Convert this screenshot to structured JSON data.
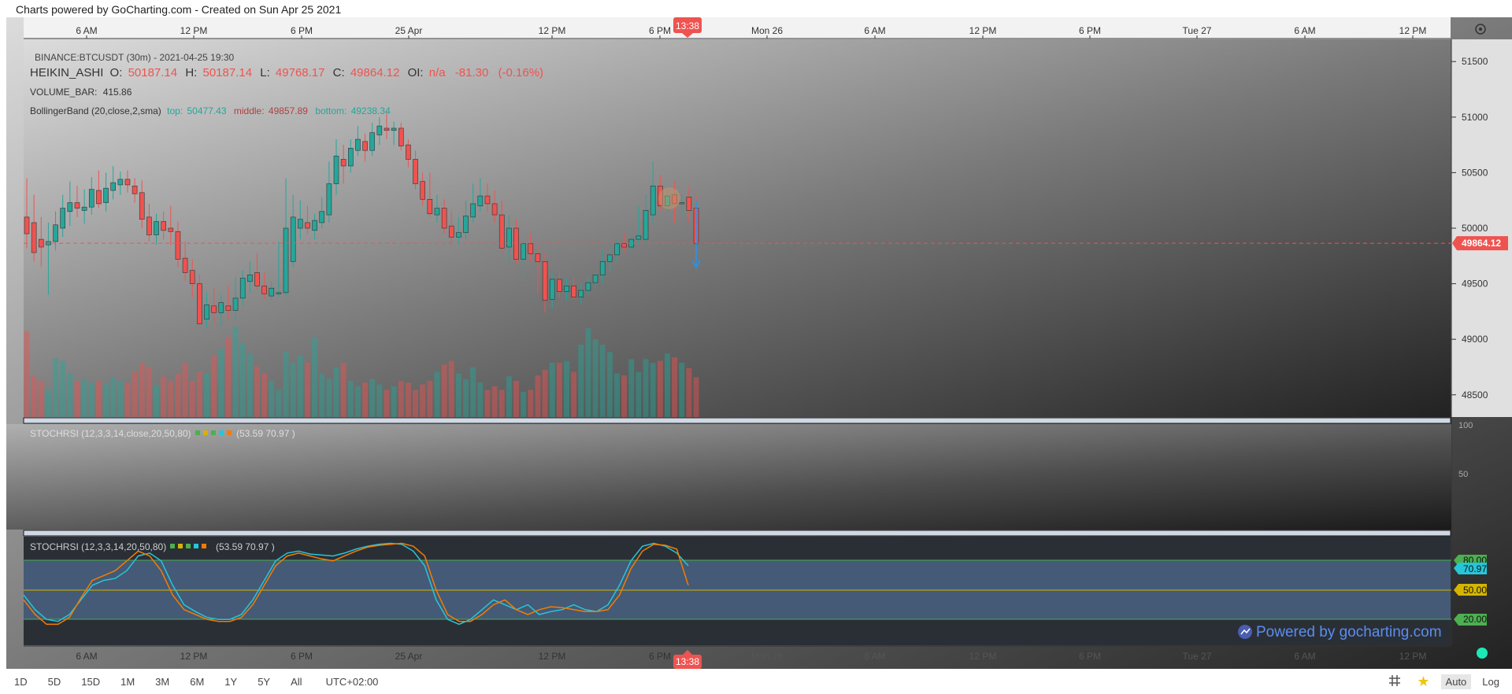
{
  "header": {
    "credit": "Charts powered by GoCharting.com - Created on Sun Apr 25 2021"
  },
  "timeaxis": {
    "ticks": [
      "6 AM",
      "12 PM",
      "6 PM",
      "25 Apr",
      "12 PM",
      "6 PM",
      "Mon 26",
      "6 AM",
      "12 PM",
      "6 PM",
      "Tue 27",
      "6 AM",
      "12 PM"
    ],
    "crosshair_time": "13:38"
  },
  "legend": {
    "symbol": "BINANCE:BTCUSDT (30m) - 2021-04-25 19:30",
    "ha_label": "HEIKIN_ASHI",
    "o_label": "O:",
    "o_value": "50187.14",
    "h_label": "H:",
    "h_value": "50187.14",
    "l_label": "L:",
    "l_value": "49768.17",
    "c_label": "C:",
    "c_value": "49864.12",
    "oi_label": "OI:",
    "oi_value": "n/a",
    "change": "-81.30",
    "change_pct": "(-0.16%)",
    "volume_label": "VOLUME_BAR:",
    "volume_value": "415.86",
    "bb_label": "BollingerBand (20,close,2,sma)",
    "bb_top_label": "top:",
    "bb_top": "50477.43",
    "bb_mid_label": "middle:",
    "bb_mid": "49857.89",
    "bb_bot_label": "bottom:",
    "bb_bot": "49238.34",
    "stoch1_label": "STOCHRSI (12,3,3,14,close,20,50,80)",
    "stoch1_values": "(53.59 70.97 )",
    "stoch2_label": "STOCHRSI (12,3,3,14,20,50,80)",
    "stoch2_values": "(53.59 70.97 )"
  },
  "price_axis": {
    "ticks": [
      "51500",
      "51000",
      "50500",
      "50000",
      "49500",
      "49000",
      "48500"
    ],
    "current": "49864.12",
    "current_color": "#ef5350"
  },
  "pane2_axis": [
    "100",
    "50"
  ],
  "stoch_levels": [
    "80.00",
    "50.00",
    "20.00"
  ],
  "stoch_badge": "70.97",
  "watermark": "Powered by gocharting.com",
  "colors": {
    "up": "#26a69a",
    "down": "#ef5350",
    "k_line": "#26c6da",
    "d_line": "#f57c00",
    "level_green": "#4caf50",
    "level_yellow": "#d4b400"
  },
  "bottom_bar": {
    "timeframes": [
      "1D",
      "5D",
      "15D",
      "1M",
      "3M",
      "6M",
      "1Y",
      "5Y",
      "All"
    ],
    "timezone": "UTC+02:00",
    "auto": "Auto",
    "log": "Log"
  },
  "chart_data": {
    "type": "candlestick",
    "title": "BINANCE:BTCUSDT (30m)",
    "ylim": [
      48300,
      51700
    ],
    "candles": [
      {
        "o": 50100,
        "h": 50450,
        "l": 49820,
        "c": 49950
      },
      {
        "o": 50050,
        "h": 50300,
        "l": 49700,
        "c": 49780
      },
      {
        "o": 49900,
        "h": 50100,
        "l": 49650,
        "c": 49830
      },
      {
        "o": 49850,
        "h": 50050,
        "l": 49400,
        "c": 49880
      },
      {
        "o": 49880,
        "h": 50150,
        "l": 49800,
        "c": 50030
      },
      {
        "o": 50000,
        "h": 50300,
        "l": 49920,
        "c": 50180
      },
      {
        "o": 50150,
        "h": 50420,
        "l": 50020,
        "c": 50230
      },
      {
        "o": 50230,
        "h": 50380,
        "l": 50100,
        "c": 50180
      },
      {
        "o": 50160,
        "h": 50350,
        "l": 50040,
        "c": 50190
      },
      {
        "o": 50190,
        "h": 50460,
        "l": 50120,
        "c": 50350
      },
      {
        "o": 50340,
        "h": 50520,
        "l": 50180,
        "c": 50220
      },
      {
        "o": 50230,
        "h": 50500,
        "l": 50150,
        "c": 50360
      },
      {
        "o": 50340,
        "h": 50560,
        "l": 50260,
        "c": 50410
      },
      {
        "o": 50390,
        "h": 50510,
        "l": 50300,
        "c": 50440
      },
      {
        "o": 50440,
        "h": 50520,
        "l": 50320,
        "c": 50390
      },
      {
        "o": 50380,
        "h": 50450,
        "l": 50230,
        "c": 50310
      },
      {
        "o": 50320,
        "h": 50430,
        "l": 50000,
        "c": 50080
      },
      {
        "o": 50100,
        "h": 50220,
        "l": 49880,
        "c": 49940
      },
      {
        "o": 49940,
        "h": 50130,
        "l": 49850,
        "c": 50060
      },
      {
        "o": 50060,
        "h": 50150,
        "l": 49900,
        "c": 49980
      },
      {
        "o": 50000,
        "h": 50200,
        "l": 49850,
        "c": 49970
      },
      {
        "o": 49970,
        "h": 50060,
        "l": 49650,
        "c": 49720
      },
      {
        "o": 49730,
        "h": 49880,
        "l": 49520,
        "c": 49600
      },
      {
        "o": 49620,
        "h": 49720,
        "l": 49380,
        "c": 49500
      },
      {
        "o": 49500,
        "h": 49580,
        "l": 49120,
        "c": 49140
      },
      {
        "o": 49180,
        "h": 49420,
        "l": 49100,
        "c": 49310
      },
      {
        "o": 49300,
        "h": 49460,
        "l": 49140,
        "c": 49240
      },
      {
        "o": 49240,
        "h": 49400,
        "l": 49120,
        "c": 49330
      },
      {
        "o": 49300,
        "h": 49480,
        "l": 49180,
        "c": 49260
      },
      {
        "o": 49260,
        "h": 49560,
        "l": 49180,
        "c": 49370
      },
      {
        "o": 49370,
        "h": 49620,
        "l": 49300,
        "c": 49550
      },
      {
        "o": 49520,
        "h": 49700,
        "l": 49420,
        "c": 49580
      },
      {
        "o": 49600,
        "h": 49780,
        "l": 49450,
        "c": 49480
      },
      {
        "o": 49480,
        "h": 49600,
        "l": 49360,
        "c": 49410
      },
      {
        "o": 49390,
        "h": 49520,
        "l": 49350,
        "c": 49460
      },
      {
        "o": 49420,
        "h": 49880,
        "l": 49380,
        "c": 49420
      },
      {
        "o": 49420,
        "h": 50450,
        "l": 49380,
        "c": 50000
      },
      {
        "o": 49700,
        "h": 50300,
        "l": 49650,
        "c": 50100
      },
      {
        "o": 50000,
        "h": 50250,
        "l": 49900,
        "c": 50080
      },
      {
        "o": 50050,
        "h": 50200,
        "l": 49950,
        "c": 50000
      },
      {
        "o": 49980,
        "h": 50130,
        "l": 49900,
        "c": 50070
      },
      {
        "o": 50050,
        "h": 50280,
        "l": 50000,
        "c": 50150
      },
      {
        "o": 50120,
        "h": 50600,
        "l": 50050,
        "c": 50400
      },
      {
        "o": 50400,
        "h": 50800,
        "l": 50300,
        "c": 50650
      },
      {
        "o": 50620,
        "h": 50750,
        "l": 50400,
        "c": 50560
      },
      {
        "o": 50560,
        "h": 50800,
        "l": 50500,
        "c": 50720
      },
      {
        "o": 50700,
        "h": 50920,
        "l": 50650,
        "c": 50800
      },
      {
        "o": 50780,
        "h": 50850,
        "l": 50600,
        "c": 50700
      },
      {
        "o": 50700,
        "h": 50950,
        "l": 50650,
        "c": 50860
      },
      {
        "o": 50840,
        "h": 51000,
        "l": 50750,
        "c": 50920
      },
      {
        "o": 50900,
        "h": 51050,
        "l": 50800,
        "c": 50880
      },
      {
        "o": 50880,
        "h": 50960,
        "l": 50750,
        "c": 50900
      },
      {
        "o": 50900,
        "h": 50950,
        "l": 50700,
        "c": 50740
      },
      {
        "o": 50750,
        "h": 50800,
        "l": 50550,
        "c": 50620
      },
      {
        "o": 50620,
        "h": 50700,
        "l": 50350,
        "c": 50400
      },
      {
        "o": 50420,
        "h": 50500,
        "l": 50200,
        "c": 50260
      },
      {
        "o": 50260,
        "h": 50500,
        "l": 50100,
        "c": 50130
      },
      {
        "o": 50120,
        "h": 50300,
        "l": 50050,
        "c": 50180
      },
      {
        "o": 50180,
        "h": 50260,
        "l": 49950,
        "c": 50000
      },
      {
        "o": 50020,
        "h": 50150,
        "l": 49850,
        "c": 49920
      },
      {
        "o": 49920,
        "h": 50100,
        "l": 49850,
        "c": 49960
      },
      {
        "o": 49960,
        "h": 50250,
        "l": 49900,
        "c": 50110
      },
      {
        "o": 50100,
        "h": 50400,
        "l": 50050,
        "c": 50220
      },
      {
        "o": 50200,
        "h": 50450,
        "l": 50150,
        "c": 50290
      },
      {
        "o": 50290,
        "h": 50400,
        "l": 50150,
        "c": 50220
      },
      {
        "o": 50220,
        "h": 50340,
        "l": 50050,
        "c": 50120
      },
      {
        "o": 50120,
        "h": 50250,
        "l": 49780,
        "c": 49820
      },
      {
        "o": 49830,
        "h": 50120,
        "l": 49700,
        "c": 50000
      },
      {
        "o": 50000,
        "h": 50080,
        "l": 49680,
        "c": 49720
      },
      {
        "o": 49720,
        "h": 49880,
        "l": 49520,
        "c": 49860
      },
      {
        "o": 49860,
        "h": 49960,
        "l": 49700,
        "c": 49770
      },
      {
        "o": 49770,
        "h": 49850,
        "l": 49420,
        "c": 49700
      },
      {
        "o": 49700,
        "h": 49780,
        "l": 49240,
        "c": 49350
      },
      {
        "o": 49360,
        "h": 49600,
        "l": 49280,
        "c": 49540
      },
      {
        "o": 49540,
        "h": 49600,
        "l": 49380,
        "c": 49430
      },
      {
        "o": 49430,
        "h": 49550,
        "l": 49350,
        "c": 49480
      },
      {
        "o": 49480,
        "h": 49560,
        "l": 49360,
        "c": 49380
      },
      {
        "o": 49380,
        "h": 49500,
        "l": 49320,
        "c": 49440
      },
      {
        "o": 49440,
        "h": 49560,
        "l": 49400,
        "c": 49510
      },
      {
        "o": 49510,
        "h": 49600,
        "l": 49450,
        "c": 49580
      },
      {
        "o": 49580,
        "h": 49800,
        "l": 49500,
        "c": 49700
      },
      {
        "o": 49700,
        "h": 49850,
        "l": 49600,
        "c": 49760
      },
      {
        "o": 49760,
        "h": 49900,
        "l": 49700,
        "c": 49860
      },
      {
        "o": 49860,
        "h": 49950,
        "l": 49780,
        "c": 49830
      },
      {
        "o": 49830,
        "h": 49950,
        "l": 49780,
        "c": 49900
      },
      {
        "o": 49900,
        "h": 50200,
        "l": 49850,
        "c": 49930
      },
      {
        "o": 49900,
        "h": 50300,
        "l": 49850,
        "c": 50160
      },
      {
        "o": 50120,
        "h": 50600,
        "l": 50050,
        "c": 50380
      },
      {
        "o": 50380,
        "h": 50480,
        "l": 50150,
        "c": 50200
      },
      {
        "o": 50200,
        "h": 50350,
        "l": 50150,
        "c": 50290
      },
      {
        "o": 50300,
        "h": 50420,
        "l": 50050,
        "c": 50220
      },
      {
        "o": 50220,
        "h": 50300,
        "l": 50120,
        "c": 50230
      },
      {
        "o": 50280,
        "h": 50380,
        "l": 50050,
        "c": 50160
      },
      {
        "o": 50180,
        "h": 50300,
        "l": 49760,
        "c": 49860
      }
    ],
    "volume_max": 100,
    "volume": [
      95,
      45,
      40,
      30,
      65,
      62,
      48,
      40,
      42,
      38,
      40,
      36,
      44,
      40,
      38,
      50,
      60,
      55,
      35,
      45,
      40,
      48,
      60,
      40,
      50,
      48,
      68,
      75,
      88,
      100,
      82,
      70,
      56,
      48,
      40,
      30,
      72,
      60,
      68,
      60,
      88,
      48,
      42,
      55,
      60,
      40,
      34,
      38,
      42,
      36,
      30,
      34,
      40,
      38,
      30,
      36,
      40,
      50,
      58,
      62,
      48,
      42,
      55,
      38,
      30,
      34,
      30,
      45,
      40,
      28,
      30,
      46,
      52,
      60,
      60,
      62,
      50,
      80,
      98,
      86,
      80,
      72,
      48,
      46,
      64,
      50,
      64,
      60,
      62,
      70,
      66,
      60,
      54,
      44,
      40
    ]
  },
  "stoch_data": {
    "k": [
      45,
      30,
      20,
      18,
      25,
      40,
      55,
      60,
      62,
      70,
      85,
      88,
      80,
      55,
      35,
      28,
      22,
      20,
      20,
      25,
      40,
      60,
      80,
      88,
      90,
      87,
      86,
      85,
      88,
      92,
      95,
      97,
      98,
      97,
      90,
      75,
      40,
      20,
      15,
      20,
      30,
      40,
      35,
      30,
      35,
      25,
      28,
      30,
      35,
      30,
      28,
      35,
      55,
      80,
      95,
      98,
      95,
      88,
      75
    ],
    "d": [
      40,
      25,
      15,
      15,
      22,
      42,
      60,
      65,
      70,
      80,
      90,
      85,
      70,
      45,
      30,
      25,
      20,
      18,
      18,
      22,
      35,
      55,
      75,
      85,
      88,
      85,
      82,
      80,
      85,
      90,
      94,
      96,
      97,
      98,
      95,
      85,
      50,
      25,
      18,
      18,
      25,
      35,
      40,
      30,
      25,
      30,
      33,
      32,
      30,
      28,
      28,
      30,
      45,
      72,
      90,
      97,
      96,
      92,
      55
    ]
  }
}
